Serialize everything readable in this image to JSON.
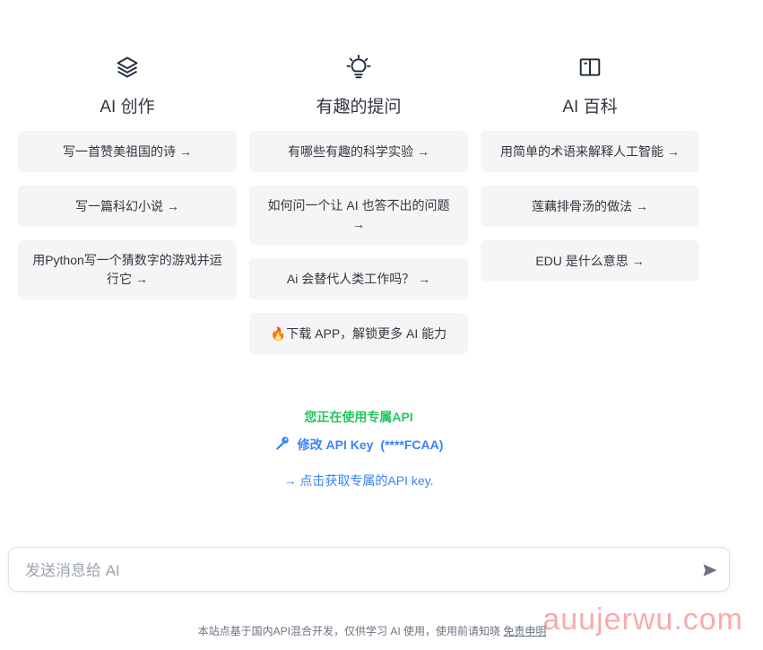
{
  "columns": [
    {
      "icon": "layers-icon",
      "title": "AI 创作",
      "cards": [
        "写一首赞美祖国的诗 →",
        "写一篇科幻小说 →",
        "用Python写一个猜数字的游戏并运行它 →"
      ]
    },
    {
      "icon": "lightbulb-icon",
      "title": "有趣的提问",
      "cards": [
        "有哪些有趣的科学实验 →",
        "如何问一个让 AI 也答不出的问题 →",
        "Ai 会替代人类工作吗？ →",
        "🔥下载 APP，解锁更多 AI 能力"
      ]
    },
    {
      "icon": "book-icon",
      "title": "AI 百科",
      "cards": [
        "用简单的术语来解释人工智能 →",
        "莲藕排骨汤的做法 →",
        "EDU 是什么意思 →"
      ]
    }
  ],
  "api": {
    "status": "您正在使用专属API",
    "key_label": "修改 API Key",
    "key_masked": "(****FCAA)",
    "get_key_link": "→ 点击获取专属的API key."
  },
  "input": {
    "placeholder": "发送消息给 AI"
  },
  "footer": {
    "text": "本站点基于国内API混合开发，仅供学习 AI 使用，使用前请知晓",
    "link": "免责申明"
  },
  "watermark": "auujerwu.com",
  "colors": {
    "accent_blue": "#3b82f6",
    "status_green": "#22c55e",
    "card_bg": "#f5f5f5"
  }
}
